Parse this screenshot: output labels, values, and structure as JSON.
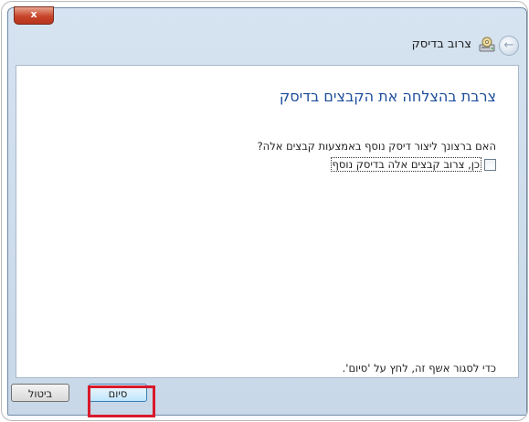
{
  "window": {
    "title": "צרוב בדיסק",
    "close_glyph": "x",
    "back_glyph": "←"
  },
  "content": {
    "heading": "צרבת בהצלחה את הקבצים בדיסק",
    "question": "האם ברצונך ליצור דיסק נוסף באמצעות קבצים אלה?",
    "checkbox_label": "כן, צרוב קבצים אלה בדיסק נוסף",
    "checkbox_checked": false,
    "footer_hint": "כדי לסגור אשף זה, לחץ על 'סיום'."
  },
  "buttons": {
    "finish": "סיום",
    "cancel": "ביטול"
  },
  "icons": {
    "close": "close-icon",
    "back": "back-arrow-icon",
    "app": "burn-disc-icon"
  },
  "colors": {
    "heading": "#1d4e9a",
    "highlight": "#d8192a"
  }
}
